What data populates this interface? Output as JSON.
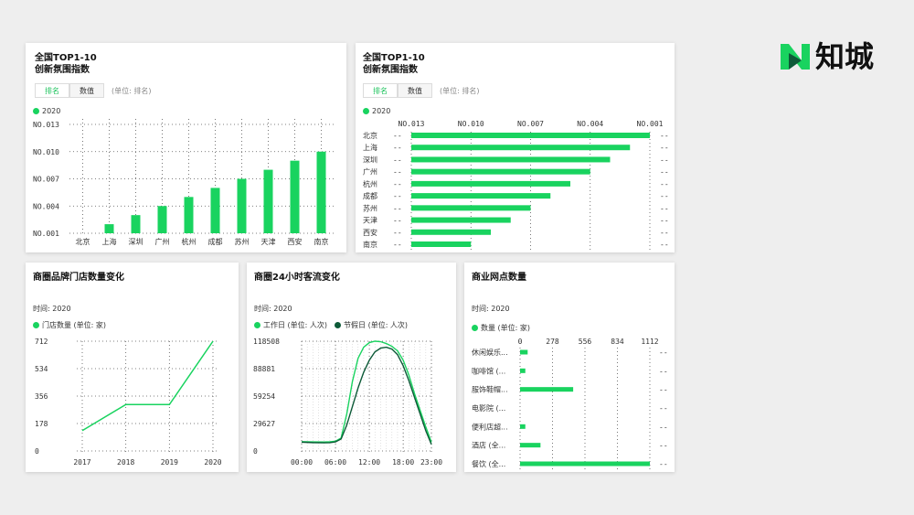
{
  "brand": {
    "name": "知城",
    "accent": "#19d35f",
    "dark": "#0d5a38"
  },
  "panels": {
    "rank_vertical": {
      "title": "全国TOP1-10\n创新氛围指数",
      "tabs": [
        "排名",
        "数值"
      ],
      "unit": "(单位: 排名)",
      "legend": "2020"
    },
    "rank_horizontal": {
      "title": "全国TOP1-10\n创新氛围指数",
      "tabs": [
        "排名",
        "数值"
      ],
      "unit": "(单位: 排名)",
      "legend": "2020"
    },
    "stores": {
      "title": "商圈品牌门店数量变化",
      "time": "时间: 2020",
      "legend": "门店数量 (单位: 家)"
    },
    "traffic": {
      "title": "商圈24小时客流变化",
      "time": "时间: 2020",
      "legend1": "工作日 (单位: 人次)",
      "legend2": "节假日 (单位: 人次)"
    },
    "outlets": {
      "title": "商业网点数量",
      "time": "时间: 2020",
      "legend": "数量 (单位: 家)"
    }
  },
  "chart_data": [
    {
      "type": "bar",
      "orientation": "vertical",
      "categories": [
        "北京",
        "上海",
        "深圳",
        "广州",
        "杭州",
        "成都",
        "苏州",
        "天津",
        "西安",
        "南京"
      ],
      "series": [
        {
          "name": "2020",
          "values": [
            1,
            2,
            3,
            4,
            5,
            6,
            7,
            8,
            9,
            10
          ]
        }
      ],
      "y_tick_labels": [
        "NO.001",
        "NO.004",
        "NO.007",
        "NO.010",
        "NO.013"
      ],
      "y_ticks": [
        1,
        4,
        7,
        10,
        13
      ],
      "ylim": [
        13,
        1
      ],
      "grid": true
    },
    {
      "type": "bar",
      "orientation": "horizontal",
      "categories": [
        "北京",
        "上海",
        "深圳",
        "广州",
        "杭州",
        "成都",
        "苏州",
        "天津",
        "西安",
        "南京"
      ],
      "series": [
        {
          "name": "2020",
          "values": [
            1,
            2,
            3,
            4,
            5,
            6,
            7,
            8,
            9,
            10
          ]
        }
      ],
      "x_tick_labels": [
        "NO.013",
        "NO.010",
        "NO.007",
        "NO.004",
        "NO.001"
      ],
      "x_ticks": [
        13,
        10,
        7,
        4,
        1
      ],
      "xlim": [
        13,
        1
      ],
      "grid": true
    },
    {
      "type": "line",
      "x": [
        "2017",
        "2018",
        "2019",
        "2020"
      ],
      "series": [
        {
          "name": "门店数量 (单位: 家)",
          "values": [
            132,
            301,
            301,
            712
          ]
        }
      ],
      "y_tick_labels": [
        "0",
        "178",
        "356",
        "534",
        "712"
      ],
      "ylim": [
        0,
        712
      ],
      "grid": true
    },
    {
      "type": "line",
      "x_tick_labels": [
        "00:00",
        "06:00",
        "12:00",
        "18:00",
        "23:00"
      ],
      "x": [
        0,
        2,
        4,
        5,
        6,
        7,
        8,
        9,
        10,
        11,
        12,
        13,
        14,
        15,
        16,
        17,
        18,
        19,
        20,
        21,
        22,
        23
      ],
      "series": [
        {
          "name": "工作日 (单位: 人次)",
          "values": [
            10000,
            9800,
            9700,
            9900,
            10500,
            14000,
            40000,
            75000,
            100000,
            112000,
            117000,
            118508,
            118000,
            116000,
            113000,
            108000,
            98000,
            82000,
            62000,
            44000,
            26000,
            9500
          ]
        },
        {
          "name": "节假日 (单位: 人次)",
          "values": [
            9500,
            9000,
            8800,
            8900,
            9800,
            13000,
            28000,
            48000,
            68000,
            85000,
            98000,
            107000,
            111000,
            112000,
            110000,
            104000,
            92000,
            76000,
            58000,
            40000,
            22000,
            7000
          ]
        }
      ],
      "y_tick_labels": [
        "0",
        "29627",
        "59254",
        "88881",
        "118508"
      ],
      "ylim": [
        0,
        118508
      ],
      "grid": true
    },
    {
      "type": "bar",
      "orientation": "horizontal",
      "categories": [
        "休闲娱乐...",
        "咖啡馆 (...",
        "服饰鞋帽...",
        "电影院 (...",
        "便利店超...",
        "酒店 (全...",
        "餐饮 (全..."
      ],
      "series": [
        {
          "name": "数量 (单位: 家)",
          "values": [
            65,
            45,
            455,
            0,
            45,
            175,
            1112
          ]
        }
      ],
      "x_tick_labels": [
        "0",
        "278",
        "556",
        "834",
        "1112"
      ],
      "xlim": [
        0,
        1112
      ],
      "grid": true
    }
  ]
}
